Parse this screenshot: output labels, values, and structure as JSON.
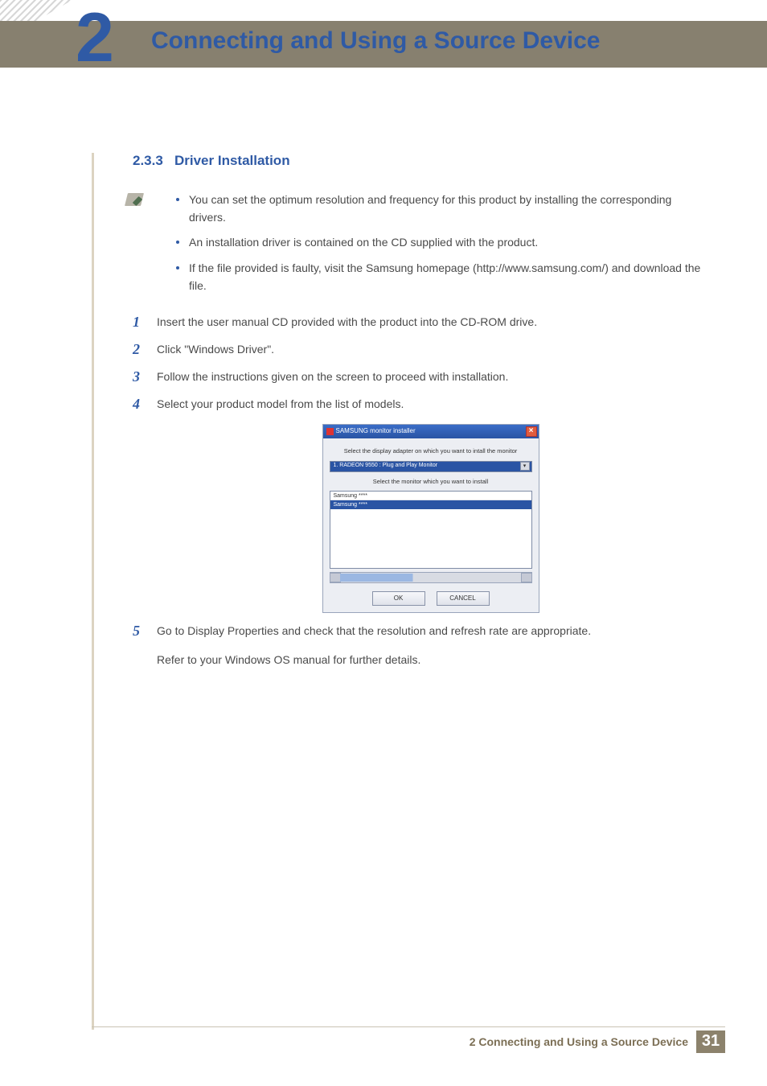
{
  "chapter": {
    "number": "2",
    "title": "Connecting and Using a Source Device"
  },
  "section": {
    "number": "2.3.3",
    "title": "Driver Installation"
  },
  "notes": [
    "You can set the optimum resolution and frequency for this product by installing the corresponding drivers.",
    "An installation driver is contained on the CD supplied with the product.",
    "If the file provided is faulty, visit the Samsung homepage (http://www.samsung.com/) and download the file."
  ],
  "steps": [
    "Insert the user manual CD provided with the product into the CD-ROM drive.",
    "Click \"Windows Driver\".",
    "Follow the instructions given on the screen to proceed with installation.",
    "Select your product model from the list of models.",
    "Go to Display Properties and check that the resolution and refresh rate are appropriate."
  ],
  "step5_extra": "Refer to your Windows OS manual for further details.",
  "installer": {
    "title": "SAMSUNG monitor installer",
    "prompt_adapter": "Select the display adapter on which you want to intall the monitor",
    "adapter": "1. RADEON 9550 : Plug and Play Monitor",
    "prompt_monitor": "Select the monitor which you want to install",
    "list": [
      "Samsung ****",
      "Samsung ****"
    ],
    "ok": "OK",
    "cancel": "CANCEL"
  },
  "footer": {
    "text": "2 Connecting and Using a Source Device",
    "page": "31"
  }
}
